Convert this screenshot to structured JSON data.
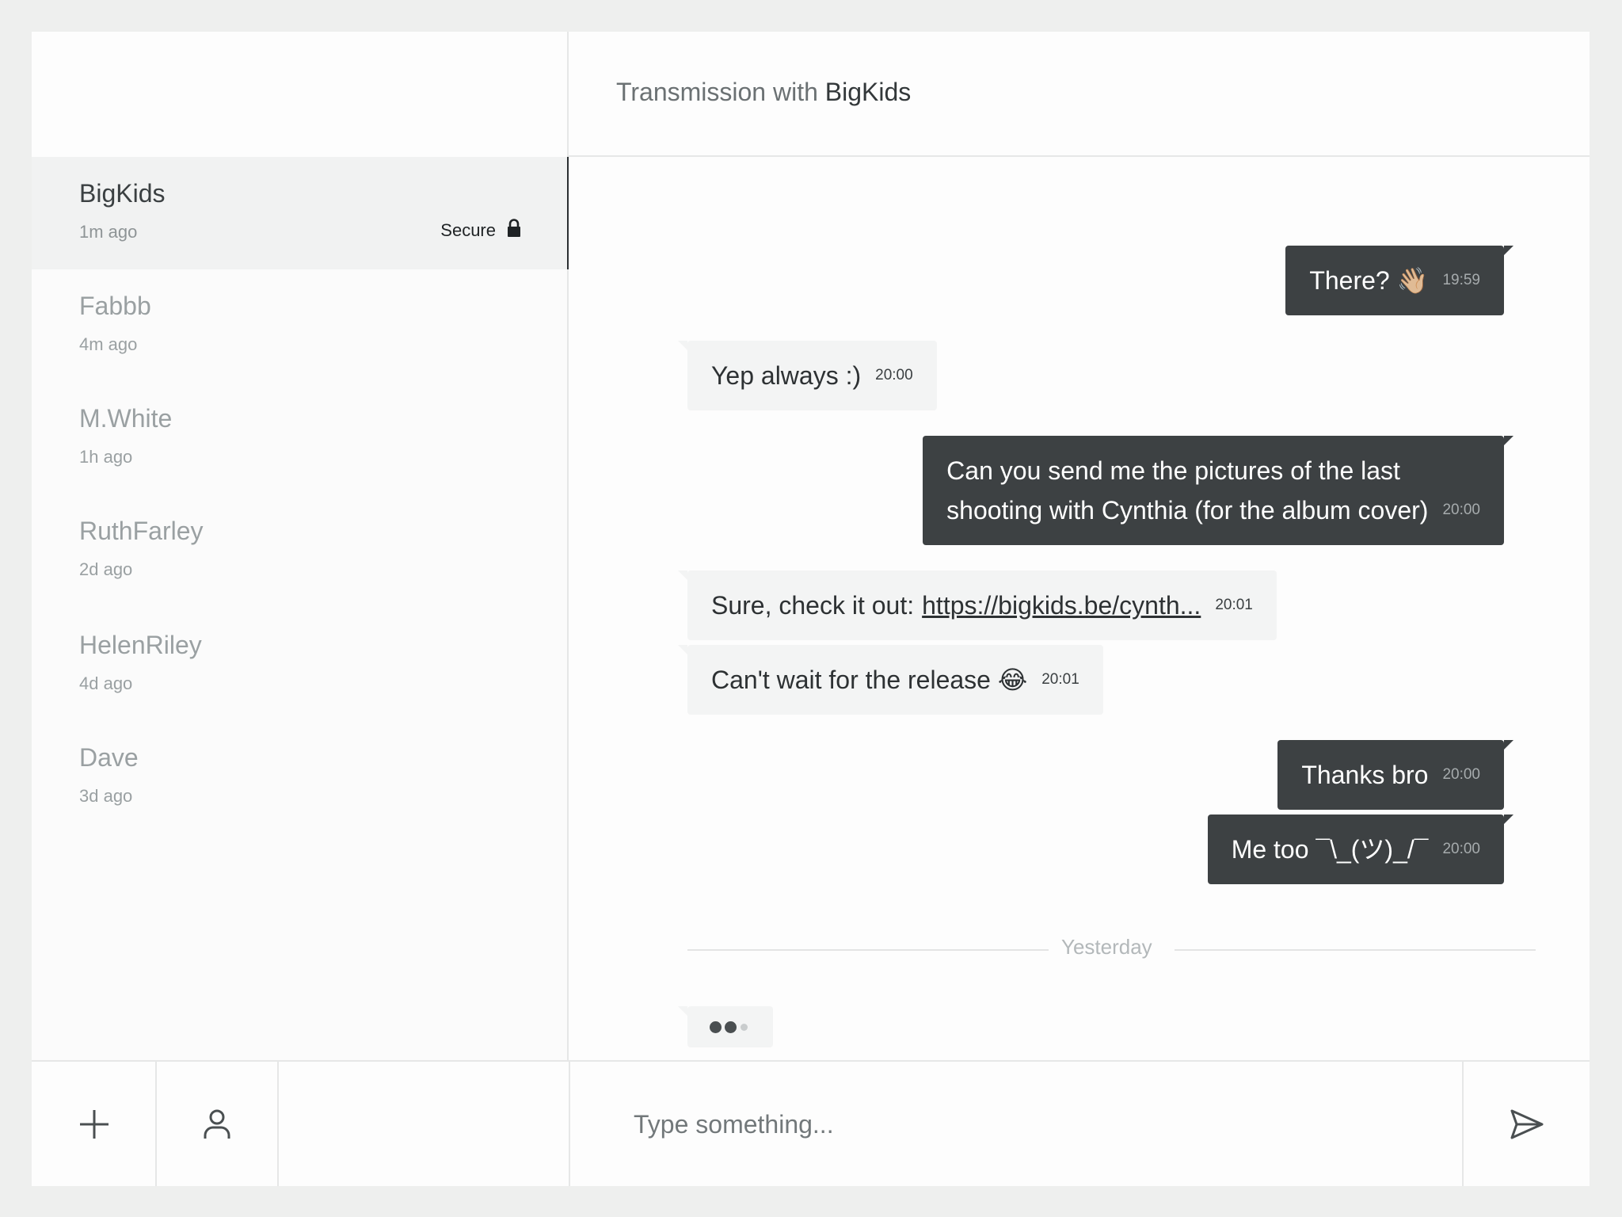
{
  "sidebar": {
    "contacts": [
      {
        "name": "BigKids",
        "time": "1m ago",
        "secure_label": "Secure",
        "icon": "lock-icon"
      },
      {
        "name": "Fabbb",
        "time": "4m ago"
      },
      {
        "name": "M.White",
        "time": "1h ago"
      },
      {
        "name": "RuthFarley",
        "time": "2d ago"
      },
      {
        "name": "HelenRiley",
        "time": "4d ago"
      },
      {
        "name": "Dave",
        "time": "3d ago"
      }
    ]
  },
  "chat": {
    "title_prefix": "Transmission with",
    "peer_name": "BigKids",
    "messages": [
      {
        "direction": "out",
        "text": "There? 👋🏼",
        "time": "19:59"
      },
      {
        "direction": "in",
        "text": "Yep always :)",
        "time": "20:00"
      },
      {
        "direction": "out",
        "text_line1": "Can you send me the pictures of the last",
        "text_line2": "shooting with Cynthia (for the album cover)",
        "time": "20:00"
      },
      {
        "direction": "in",
        "text": "Sure, check it out:",
        "link": "https://bigkids.be/cynth...",
        "time": "20:01"
      },
      {
        "direction": "in",
        "text": "Can't wait for the release 😂",
        "time": "20:01"
      },
      {
        "direction": "out",
        "text": "Thanks bro",
        "time": "20:00"
      },
      {
        "direction": "out",
        "text": "Me too ¯\\_(ツ)_/¯",
        "time": "20:00"
      }
    ],
    "divider_label": "Yesterday"
  },
  "composer": {
    "placeholder": "Type something...",
    "value": ""
  },
  "icons": {
    "add": "plus-icon",
    "profile": "user-icon",
    "send": "send-icon",
    "secure": "lock-icon"
  },
  "colors": {
    "outgoing_bubble": "#3d4143",
    "incoming_bubble": "#f3f4f4",
    "active_contact_bg": "#f1f2f2",
    "background": "#eeefee"
  }
}
